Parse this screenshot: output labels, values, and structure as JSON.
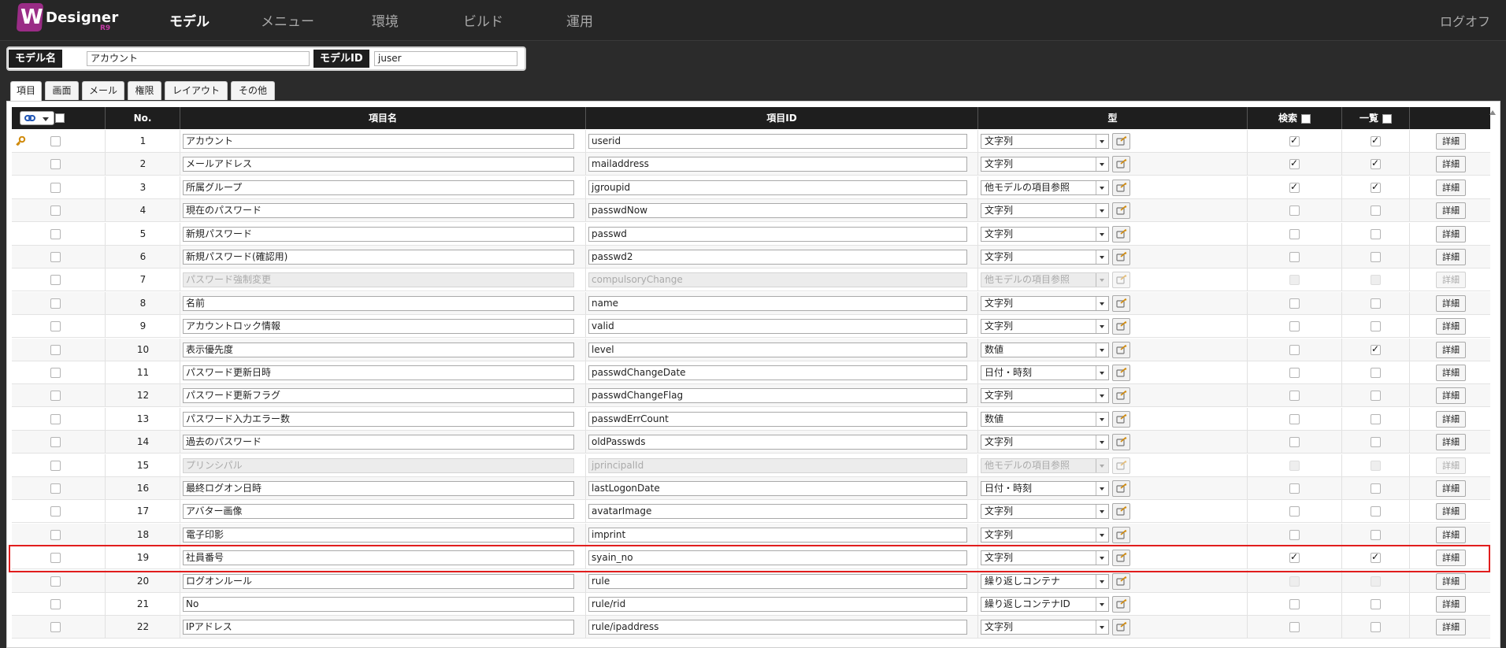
{
  "logo": {
    "mark": "W",
    "name": "Designer",
    "version": "R9"
  },
  "nav": {
    "items": [
      "モデル",
      "メニュー",
      "環境",
      "ビルド",
      "運用"
    ],
    "active": 0,
    "logout": "ログオフ"
  },
  "model": {
    "name_label": "モデル名",
    "name_value": "アカウント",
    "id_label": "モデルID",
    "id_value": "juser"
  },
  "tabs": [
    "項目",
    "画面",
    "メール",
    "権限",
    "レイアウト",
    "その他"
  ],
  "table": {
    "headers": {
      "no": "No.",
      "item_name": "項目名",
      "item_id": "項目ID",
      "type": "型",
      "search": "検索",
      "list": "一覧"
    },
    "detail_label": "詳細",
    "rows": [
      {
        "no": "1",
        "name": "アカウント",
        "id": "userid",
        "type": "文字列",
        "search": true,
        "list": true,
        "disabled": false,
        "key": true
      },
      {
        "no": "2",
        "name": "メールアドレス",
        "id": "mailaddress",
        "type": "文字列",
        "search": true,
        "list": true,
        "disabled": false
      },
      {
        "no": "3",
        "name": "所属グループ",
        "id": "jgroupid",
        "type": "他モデルの項目参照",
        "search": true,
        "list": true,
        "disabled": false
      },
      {
        "no": "4",
        "name": "現在のパスワード",
        "id": "passwdNow",
        "type": "文字列",
        "search": false,
        "list": false,
        "disabled": false
      },
      {
        "no": "5",
        "name": "新規パスワード",
        "id": "passwd",
        "type": "文字列",
        "search": false,
        "list": false,
        "disabled": false
      },
      {
        "no": "6",
        "name": "新規パスワード(確認用)",
        "id": "passwd2",
        "type": "文字列",
        "search": false,
        "list": false,
        "disabled": false
      },
      {
        "no": "7",
        "name": "パスワード強制変更",
        "id": "compulsoryChange",
        "type": "他モデルの項目参照",
        "search": false,
        "list": false,
        "disabled": true
      },
      {
        "no": "8",
        "name": "名前",
        "id": "name",
        "type": "文字列",
        "search": false,
        "list": false,
        "disabled": false
      },
      {
        "no": "9",
        "name": "アカウントロック情報",
        "id": "valid",
        "type": "文字列",
        "search": false,
        "list": false,
        "disabled": false
      },
      {
        "no": "10",
        "name": "表示優先度",
        "id": "level",
        "type": "数値",
        "search": false,
        "list": true,
        "disabled": false
      },
      {
        "no": "11",
        "name": "パスワード更新日時",
        "id": "passwdChangeDate",
        "type": "日付・時刻",
        "search": false,
        "list": false,
        "disabled": false
      },
      {
        "no": "12",
        "name": "パスワード更新フラグ",
        "id": "passwdChangeFlag",
        "type": "文字列",
        "search": false,
        "list": false,
        "disabled": false
      },
      {
        "no": "13",
        "name": "パスワード入力エラー数",
        "id": "passwdErrCount",
        "type": "数値",
        "search": false,
        "list": false,
        "disabled": false
      },
      {
        "no": "14",
        "name": "過去のパスワード",
        "id": "oldPasswds",
        "type": "文字列",
        "search": false,
        "list": false,
        "disabled": false
      },
      {
        "no": "15",
        "name": "プリンシパル",
        "id": "jprincipalId",
        "type": "他モデルの項目参照",
        "search": false,
        "list": false,
        "disabled": true
      },
      {
        "no": "16",
        "name": "最終ログオン日時",
        "id": "lastLogonDate",
        "type": "日付・時刻",
        "search": false,
        "list": false,
        "disabled": false
      },
      {
        "no": "17",
        "name": "アバター画像",
        "id": "avatarImage",
        "type": "文字列",
        "search": false,
        "list": false,
        "disabled": false
      },
      {
        "no": "18",
        "name": "電子印影",
        "id": "imprint",
        "type": "文字列",
        "search": false,
        "list": false,
        "disabled": false
      },
      {
        "no": "19",
        "name": "社員番号",
        "id": "syain_no",
        "type": "文字列",
        "search": true,
        "list": true,
        "disabled": false,
        "highlight": true
      },
      {
        "no": "20",
        "name": "ログオンルール",
        "id": "rule",
        "type": "繰り返しコンテナ",
        "search": false,
        "list": false,
        "disabled": false,
        "checks_disabled": true
      },
      {
        "no": "21",
        "name": "No",
        "id": "rule/rid",
        "type": "繰り返しコンテナID",
        "search": false,
        "list": false,
        "disabled": false
      },
      {
        "no": "22",
        "name": "IPアドレス",
        "id": "rule/ipaddress",
        "type": "文字列",
        "search": false,
        "list": false,
        "disabled": false
      }
    ]
  },
  "icons": {
    "link": "chain-link-icon",
    "key": "key-icon",
    "type_detail": "type-settings-icon"
  },
  "colors": {
    "nav_bg": "#262626",
    "logo_accent": "#9a2c86",
    "header_bg": "#1e1e1e",
    "highlight": "#e11d1d"
  }
}
